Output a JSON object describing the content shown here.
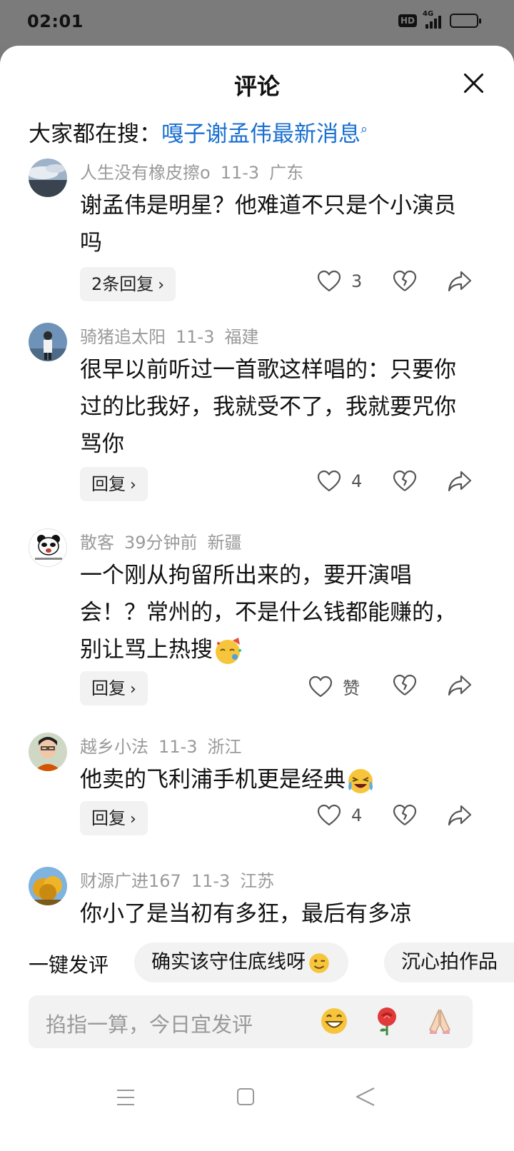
{
  "status_bar": {
    "time": "02:01",
    "hd": "HD",
    "network": "4G"
  },
  "header": {
    "title": "评论"
  },
  "search_hint": {
    "prefix": "大家都在搜：",
    "query": "嘎子谢孟伟最新消息"
  },
  "comments": [
    {
      "user": "人生没有橡皮擦o",
      "time": "11-3",
      "location": "广东",
      "text": "谢孟伟是明星？他难道不只是个小演员吗",
      "reply_label": "2条回复",
      "likes": "3",
      "avatar": "landscape-avatar"
    },
    {
      "user": "骑猪追太阳",
      "time": "11-3",
      "location": "福建",
      "text": "很早以前听过一首歌这样唱的：只要你过的比我好，我就受不了，我就要咒你骂你",
      "reply_label": "回复",
      "likes": "4",
      "avatar": "person-avatar"
    },
    {
      "user": "散客",
      "time": "39分钟前",
      "location": "新疆",
      "text": "一个刚从拘留所出来的，要开演唱会！？常州的，不是什么钱都能赚的，别让骂上热搜",
      "reply_label": "回复",
      "likes": "赞",
      "avatar": "panda-avatar",
      "emoji": "party-face-emoji"
    },
    {
      "user": "越乡小法",
      "time": "11-3",
      "location": "浙江",
      "text": "他卖的飞利浦手机更是经典",
      "reply_label": "回复",
      "likes": "4",
      "avatar": "man-avatar",
      "emoji": "laughing-crying-emoji"
    },
    {
      "user": "财源广进167",
      "time": "11-3",
      "location": "江苏",
      "text": "你小了是当初有多狂，最后有多凉",
      "avatar": "autumn-tree-avatar"
    }
  ],
  "quick_comment": {
    "label": "一键发评",
    "chips": [
      "确实该守住底线呀",
      "沉心拍作品"
    ]
  },
  "input": {
    "placeholder": "掐指一算，今日宜发评"
  },
  "colors": {
    "link": "#1a6fd0",
    "meta": "#9a9a9a",
    "chip_bg": "#f2f2f2"
  }
}
